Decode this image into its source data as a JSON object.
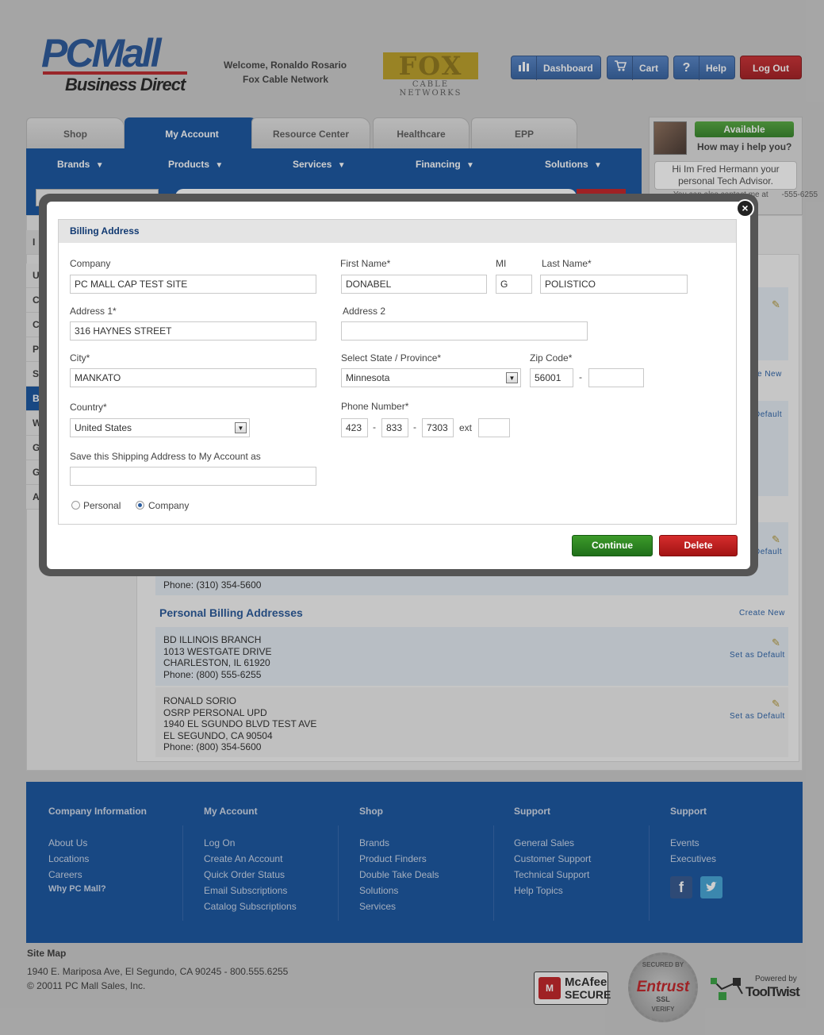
{
  "header": {
    "logo_main": "PCMall",
    "logo_sub": "Business Direct",
    "welcome_line1": "Welcome, Ronaldo Rosario",
    "welcome_line2": "Fox Cable Network",
    "partner_logo": "FOX",
    "partner_logo_sub": "CABLE NETWORKS",
    "buttons": {
      "dashboard": "Dashboard",
      "cart": "Cart",
      "help": "Help",
      "logout": "Log Out"
    }
  },
  "nav": {
    "tabs": [
      "Shop",
      "My Account",
      "Resource Center",
      "Healthcare",
      "EPP"
    ],
    "active_tab": "My Account",
    "subnav": [
      "Brands",
      "Products",
      "Services",
      "Financing",
      "Solutions"
    ]
  },
  "chat": {
    "status": "Available",
    "prompt": "How may i help you?",
    "message": "Hi Im Fred Hermann your personal Tech Advisor.",
    "more": "You can also contact me at",
    "more_phone": "-555-6255"
  },
  "sidebar": {
    "letters": [
      "I",
      "U",
      "C",
      "C",
      "P",
      "S",
      "B",
      "W",
      "G",
      "G",
      "A"
    ]
  },
  "background_content": {
    "create_new_1": "e New",
    "set_default_1": "Default",
    "set_default_2": "Default",
    "phone_partial": "Phone: (310) 354-5600",
    "personal_heading": "Personal Billing Addresses",
    "create_new": "Create New",
    "addresses": [
      {
        "lines": [
          "BD ILLINOIS BRANCH",
          "1013 WESTGATE DRIVE",
          "CHARLESTON, IL 61920",
          "Phone: (800) 555-6255"
        ],
        "action": "Set as Default"
      },
      {
        "lines": [
          "RONALD SORIO",
          "OSRP PERSONAL UPD",
          "1940 EL SGUNDO BLVD TEST AVE",
          "EL SEGUNDO, CA 90504",
          "Phone: (800) 354-5600"
        ],
        "action": "Set as Default"
      }
    ]
  },
  "modal": {
    "title": "Billing Address",
    "labels": {
      "company": "Company",
      "first_name": "First Name*",
      "mi": "MI",
      "last_name": "Last Name*",
      "address1": "Address 1*",
      "address2": "Address 2",
      "city": "City*",
      "state": "Select State / Province*",
      "zip": "Zip Code*",
      "country": "Country*",
      "phone": "Phone Number*",
      "ext": "ext",
      "save_as": "Save this Shipping Address to My Account as",
      "personal": "Personal",
      "company_radio": "Company"
    },
    "values": {
      "company": "PC MALL CAP TEST SITE",
      "first_name": "DONABEL",
      "mi": "G",
      "last_name": "POLISTICO",
      "address1": "316 HAYNES STREET",
      "address2": "",
      "city": "MANKATO",
      "state": "Minnesota",
      "zip": "56001",
      "zip_ext": "",
      "country": "United States",
      "phone_area": "423",
      "phone_prefix": "833",
      "phone_line": "7303",
      "phone_ext": "",
      "save_as": "",
      "address_type": "Company"
    },
    "buttons": {
      "continue": "Continue",
      "delete": "Delete",
      "close": "×"
    }
  },
  "footer": {
    "columns": [
      {
        "heading": "Company Information",
        "links": [
          "About Us",
          "Locations",
          "Careers",
          "Why PC Mall?"
        ]
      },
      {
        "heading": "My Account",
        "links": [
          "Log On",
          "Create An Account",
          "Quick Order Status",
          "Email Subscriptions",
          "Catalog Subscriptions"
        ]
      },
      {
        "heading": "Shop",
        "links": [
          "Brands",
          "Product Finders",
          "Double Take Deals",
          "Solutions",
          "Services"
        ]
      },
      {
        "heading": "Support",
        "links": [
          "General Sales",
          "Customer Support",
          "Technical Support",
          "Help Topics"
        ]
      },
      {
        "heading": "Support",
        "links": [
          "Events",
          "Executives"
        ]
      }
    ],
    "site_map": "Site Map",
    "address": "1940 E. Mariposa Ave, El Segundo, CA 90245 - 800.555.6255",
    "copyright": "© 20011 PC Mall Sales, Inc.",
    "badges": {
      "mcafee": "McAfee",
      "mcafee_sub": "SECURE",
      "entrust": "Entrust",
      "entrust_top": "SECURED BY",
      "entrust_ssl": "SSL",
      "entrust_bottom": "VERIFY",
      "powered_by": "Powered by",
      "tooltwist": "ToolTwist"
    }
  },
  "colors": {
    "brand_blue": "#0d4c9b",
    "continue_green": "#2b8722",
    "delete_red": "#c01f1f",
    "logout_red": "#b81a1f"
  }
}
